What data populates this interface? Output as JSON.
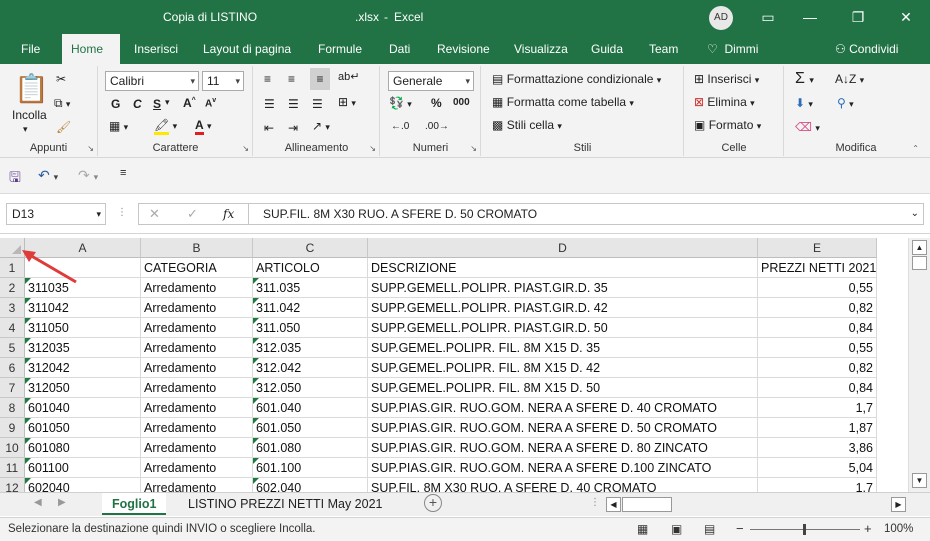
{
  "titlebar": {
    "doc_name": "Copia di LISTINO",
    "extension": ".xlsx",
    "app": "Excel",
    "avatar_initials": "AD",
    "minimize": "—",
    "restore": "❐",
    "close": "✕"
  },
  "menu": {
    "file": "File",
    "home": "Home",
    "insert": "Inserisci",
    "layout": "Layout di pagina",
    "formulas": "Formule",
    "data": "Dati",
    "review": "Revisione",
    "view": "Visualizza",
    "help": "Guida",
    "team": "Team",
    "tellme": "Dimmi",
    "share": "Condividi"
  },
  "ribbon": {
    "clipboard": {
      "paste": "Incolla",
      "label": "Appunti"
    },
    "font": {
      "name": "Calibri",
      "size": "11",
      "bold": "G",
      "italic": "C",
      "underline": "S",
      "label": "Carattere"
    },
    "alignment": {
      "label": "Allineamento"
    },
    "number": {
      "format": "Generale",
      "label": "Numeri"
    },
    "styles": {
      "conditional": "Formattazione condizionale",
      "table": "Formatta come tabella",
      "cell_styles": "Stili cella",
      "label": "Stili"
    },
    "cells": {
      "insert": "Inserisci",
      "delete": "Elimina",
      "format": "Formato",
      "label": "Celle"
    },
    "editing": {
      "label": "Modifica"
    }
  },
  "formula_bar": {
    "name_box": "D13",
    "fx": "fx",
    "content": "SUP.FIL. 8M X30 RUO. A SFERE D. 50  CROMATO"
  },
  "sheet": {
    "columns": [
      "A",
      "B",
      "C",
      "D",
      "E"
    ],
    "rows": [
      {
        "n": "1",
        "a": "",
        "b": "CATEGORIA",
        "c": "ARTICOLO",
        "d": "DESCRIZIONE",
        "e": "PREZZI NETTI 2021"
      },
      {
        "n": "2",
        "a": "311035",
        "b": "Arredamento",
        "c": "311.035",
        "d": "SUPP.GEMELL.POLIPR. PIAST.GIR.D. 35",
        "e": "0,55"
      },
      {
        "n": "3",
        "a": "311042",
        "b": "Arredamento",
        "c": "311.042",
        "d": "SUPP.GEMELL.POLIPR. PIAST.GIR.D. 42",
        "e": "0,82"
      },
      {
        "n": "4",
        "a": "311050",
        "b": "Arredamento",
        "c": "311.050",
        "d": "SUPP.GEMELL.POLIPR. PIAST.GIR.D. 50",
        "e": "0,84"
      },
      {
        "n": "5",
        "a": "312035",
        "b": "Arredamento",
        "c": "312.035",
        "d": "SUP.GEMEL.POLIPR. FIL. 8M X15 D. 35",
        "e": "0,55"
      },
      {
        "n": "6",
        "a": "312042",
        "b": "Arredamento",
        "c": "312.042",
        "d": "SUP.GEMEL.POLIPR. FIL. 8M X15 D. 42",
        "e": "0,82"
      },
      {
        "n": "7",
        "a": "312050",
        "b": "Arredamento",
        "c": "312.050",
        "d": "SUP.GEMEL.POLIPR. FIL. 8M X15 D. 50",
        "e": "0,84"
      },
      {
        "n": "8",
        "a": "601040",
        "b": "Arredamento",
        "c": "601.040",
        "d": "SUP.PIAS.GIR. RUO.GOM. NERA A SFERE  D. 40 CROMATO",
        "e": "1,7"
      },
      {
        "n": "9",
        "a": "601050",
        "b": "Arredamento",
        "c": "601.050",
        "d": "SUP.PIAS.GIR. RUO.GOM. NERA A SFERE  D. 50 CROMATO",
        "e": "1,87"
      },
      {
        "n": "10",
        "a": "601080",
        "b": "Arredamento",
        "c": "601.080",
        "d": "SUP.PIAS.GIR. RUO.GOM. NERA A SFERE  D. 80  ZINCATO",
        "e": "3,86"
      },
      {
        "n": "11",
        "a": "601100",
        "b": "Arredamento",
        "c": "601.100",
        "d": "SUP.PIAS.GIR. RUO.GOM. NERA A SFERE  D.100  ZINCATO",
        "e": "5,04"
      },
      {
        "n": "12",
        "a": "602040",
        "b": "Arredamento",
        "c": "602.040",
        "d": "SUP.FIL. 8M X30 RUO. A SFERE D. 40  CROMATO",
        "e": "1,7"
      }
    ]
  },
  "sheet_tabs": {
    "tabs": [
      "Foglio1",
      "LISTINO PREZZI NETTI May 2021"
    ],
    "active": "Foglio1",
    "add": "+"
  },
  "status": {
    "message": "Selezionare la destinazione quindi INVIO o scegliere Incolla.",
    "zoom": "100%",
    "zoom_minus": "−",
    "zoom_plus": "+"
  },
  "colors": {
    "brand": "#217346",
    "ribbon": "#f3f3f3",
    "arrow": "#e03b3b"
  }
}
